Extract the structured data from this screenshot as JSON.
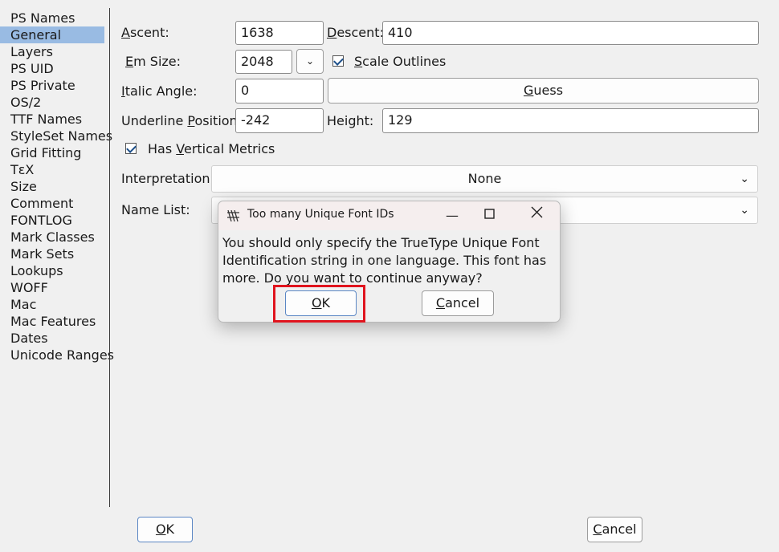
{
  "sidebar": {
    "items": [
      {
        "label": "PS Names"
      },
      {
        "label": "General",
        "selected": true
      },
      {
        "label": "Layers"
      },
      {
        "label": "PS UID"
      },
      {
        "label": "PS Private"
      },
      {
        "label": "OS/2"
      },
      {
        "label": "TTF Names"
      },
      {
        "label": "StyleSet Names"
      },
      {
        "label": "Grid Fitting"
      },
      {
        "label": "TεX"
      },
      {
        "label": "Size"
      },
      {
        "label": "Comment"
      },
      {
        "label": "FONTLOG"
      },
      {
        "label": "Mark Classes"
      },
      {
        "label": "Mark Sets"
      },
      {
        "label": "Lookups"
      },
      {
        "label": "WOFF"
      },
      {
        "label": "Mac"
      },
      {
        "label": "Mac Features"
      },
      {
        "label": "Dates"
      },
      {
        "label": "Unicode Ranges"
      }
    ]
  },
  "general": {
    "ascent_label_key": "A",
    "ascent_label_rest": "scent:",
    "ascent_value": "1638",
    "descent_label_key": "D",
    "descent_label_rest": "escent:",
    "descent_value": "410",
    "em_size_label_key": "E",
    "em_size_label_rest": "m Size:",
    "em_size_value": "2048",
    "scale_outlines_key": "S",
    "scale_outlines_rest": "cale Outlines",
    "scale_outlines_checked": true,
    "italic_angle_label_key": "I",
    "italic_angle_label_rest": "talic Angle:",
    "italic_angle_value": "0",
    "guess_key": "G",
    "guess_rest": "uess",
    "underline_position_label_pre": "Underline ",
    "underline_position_label_key": "P",
    "underline_position_label_rest": "osition:",
    "underline_position_value": "-242",
    "height_label": "Height:",
    "height_value": "129",
    "vertical_metrics_pre": "Has ",
    "vertical_metrics_key": "V",
    "vertical_metrics_rest": "ertical Metrics",
    "vertical_metrics_checked": true,
    "interpretation_label": "Interpretation:",
    "interpretation_value": "None",
    "name_list_label": "Name List:",
    "name_list_value": ""
  },
  "footer": {
    "ok_key": "O",
    "ok_rest": "K",
    "cancel_key": "C",
    "cancel_rest": "ancel"
  },
  "dialog": {
    "title": "Too many Unique Font IDs",
    "message": "You should only specify the TrueType Unique Font Identification string in one language. This font has more. Do you want to continue anyway?",
    "ok_key": "O",
    "ok_rest": "K",
    "cancel_key": "C",
    "cancel_rest": "ancel",
    "minimize_icon": "minimize-icon",
    "maximize_icon": "maximize-icon",
    "close_icon": "close-icon"
  },
  "colors": {
    "selection": "#99bbe3",
    "highlight_box": "#e0141e",
    "checkbox_check": "#1c4f8a"
  }
}
